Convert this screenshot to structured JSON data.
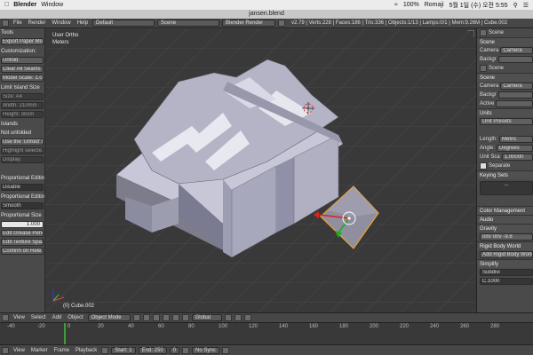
{
  "mac_menu": {
    "apple": "",
    "app": "Blender",
    "window": "Window",
    "battery": "100%",
    "input": "Romaji",
    "datetime": "5월 1일 (수) 오전 5:55"
  },
  "window_title": "jansen.blend",
  "top": {
    "menus": [
      "File",
      "Render",
      "Window",
      "Help"
    ],
    "layout": "Default",
    "scene": "Scene",
    "engine": "Blender Render",
    "stats": "v2.79 | Verts:228 | Faces:186 | Tris:336 | Objects:1/13 | Lamps:0/1 | Mem:9.26M | Cube.002"
  },
  "toolshelf": {
    "items": [
      {
        "t": "h",
        "text": "Tools"
      },
      {
        "t": "b",
        "text": "Export Paper Model"
      },
      {
        "t": "h",
        "text": "Customization:"
      },
      {
        "t": "b",
        "text": "Unfold"
      },
      {
        "t": "b",
        "text": "Clear All Seams"
      },
      {
        "t": "b",
        "text": "Model Scale: 1.0"
      },
      {
        "t": "h",
        "text": "Limit Island Size"
      },
      {
        "t": "d",
        "text": "Size:     A4"
      },
      {
        "t": "d",
        "text": "Width:    210mm"
      },
      {
        "t": "d",
        "text": "Height:   30cm"
      },
      {
        "t": "h",
        "text": "Islands"
      },
      {
        "t": "h",
        "text": "Not unfolded"
      },
      {
        "t": "b",
        "text": "Use the 'Unfold' t..."
      },
      {
        "t": "d",
        "text": "Highlight selecte..."
      },
      {
        "t": "d",
        "text": "Display:"
      },
      {
        "t": "h",
        "text": ""
      },
      {
        "t": "h",
        "text": "Proportional Editing"
      },
      {
        "t": "s",
        "text": "Disable"
      },
      {
        "t": "h",
        "text": "Proportional Editing"
      },
      {
        "t": "s",
        "text": "Smooth"
      },
      {
        "t": "h",
        "text": "Proportional Size"
      },
      {
        "t": "w",
        "text": "1.000"
      },
      {
        "t": "b",
        "text": "Edit Grease Pencil"
      },
      {
        "t": "b",
        "text": "Edit Texture Spa..."
      },
      {
        "t": "b",
        "text": "Confirm on Rele..."
      }
    ]
  },
  "viewport": {
    "view_name": "User Ortho",
    "units": "Meters",
    "object_label": "(0) Cube.002"
  },
  "properties": {
    "rows": [
      {
        "t": "tab",
        "text": "Scene"
      },
      {
        "t": "ph",
        "text": "Scene"
      },
      {
        "t": "f",
        "label": "Camera",
        "value": "Camera"
      },
      {
        "t": "f",
        "label": "Backgr",
        "value": ""
      },
      {
        "t": "tab",
        "text": "Scene"
      },
      {
        "t": "ph",
        "text": "Scene"
      },
      {
        "t": "f",
        "label": "Camera",
        "value": "Camera"
      },
      {
        "t": "f",
        "label": "Backgr",
        "value": ""
      },
      {
        "t": "f",
        "label": "Active",
        "value": ""
      },
      {
        "t": "ph",
        "text": "Units"
      },
      {
        "t": "f",
        "label": "",
        "value": "Unit Presets"
      },
      {
        "t": "sp",
        "text": ""
      },
      {
        "t": "f",
        "label": "Length:",
        "value": "Metric"
      },
      {
        "t": "f",
        "label": "Angle:",
        "value": "Degrees"
      },
      {
        "t": "f",
        "label": "Unit Sca",
        "value": "1.00000"
      },
      {
        "t": "c",
        "text": "Separate"
      },
      {
        "t": "ph",
        "text": "Keying Sets"
      },
      {
        "t": "big",
        "text": "..."
      },
      {
        "t": "sp",
        "text": ""
      },
      {
        "t": "ph",
        "text": "Color Management"
      },
      {
        "t": "ph",
        "text": "Audio"
      },
      {
        "t": "ph",
        "text": "Gravity"
      },
      {
        "t": "g",
        "text": "0m/   0m/   -9.8"
      },
      {
        "t": "ph",
        "text": "Rigid Body World"
      },
      {
        "t": "f",
        "label": "",
        "value": "Add Rigid Body World"
      },
      {
        "t": "ph",
        "text": "Simplify"
      },
      {
        "t": "d",
        "text": "Subdivi"
      },
      {
        "t": "d",
        "text": "C.1000"
      }
    ]
  },
  "header3d": {
    "items": [
      "View",
      "Select",
      "Add",
      "Object"
    ],
    "mode": "Object Mode",
    "pivot": "Global"
  },
  "timeline": {
    "ticks": [
      "-40",
      "-20",
      "0",
      "20",
      "40",
      "60",
      "80",
      "100",
      "120",
      "140",
      "160",
      "180",
      "200",
      "220",
      "240",
      "260",
      "280"
    ]
  },
  "timebar": {
    "items": [
      "View",
      "Marker",
      "Frame",
      "Playback"
    ],
    "start": "Start:",
    "start_val": "1",
    "end": "End:",
    "end_val": "250",
    "current": "0",
    "sync": "No Sync"
  },
  "colors": {
    "accent": "#f0a030",
    "bg": "#393939"
  }
}
